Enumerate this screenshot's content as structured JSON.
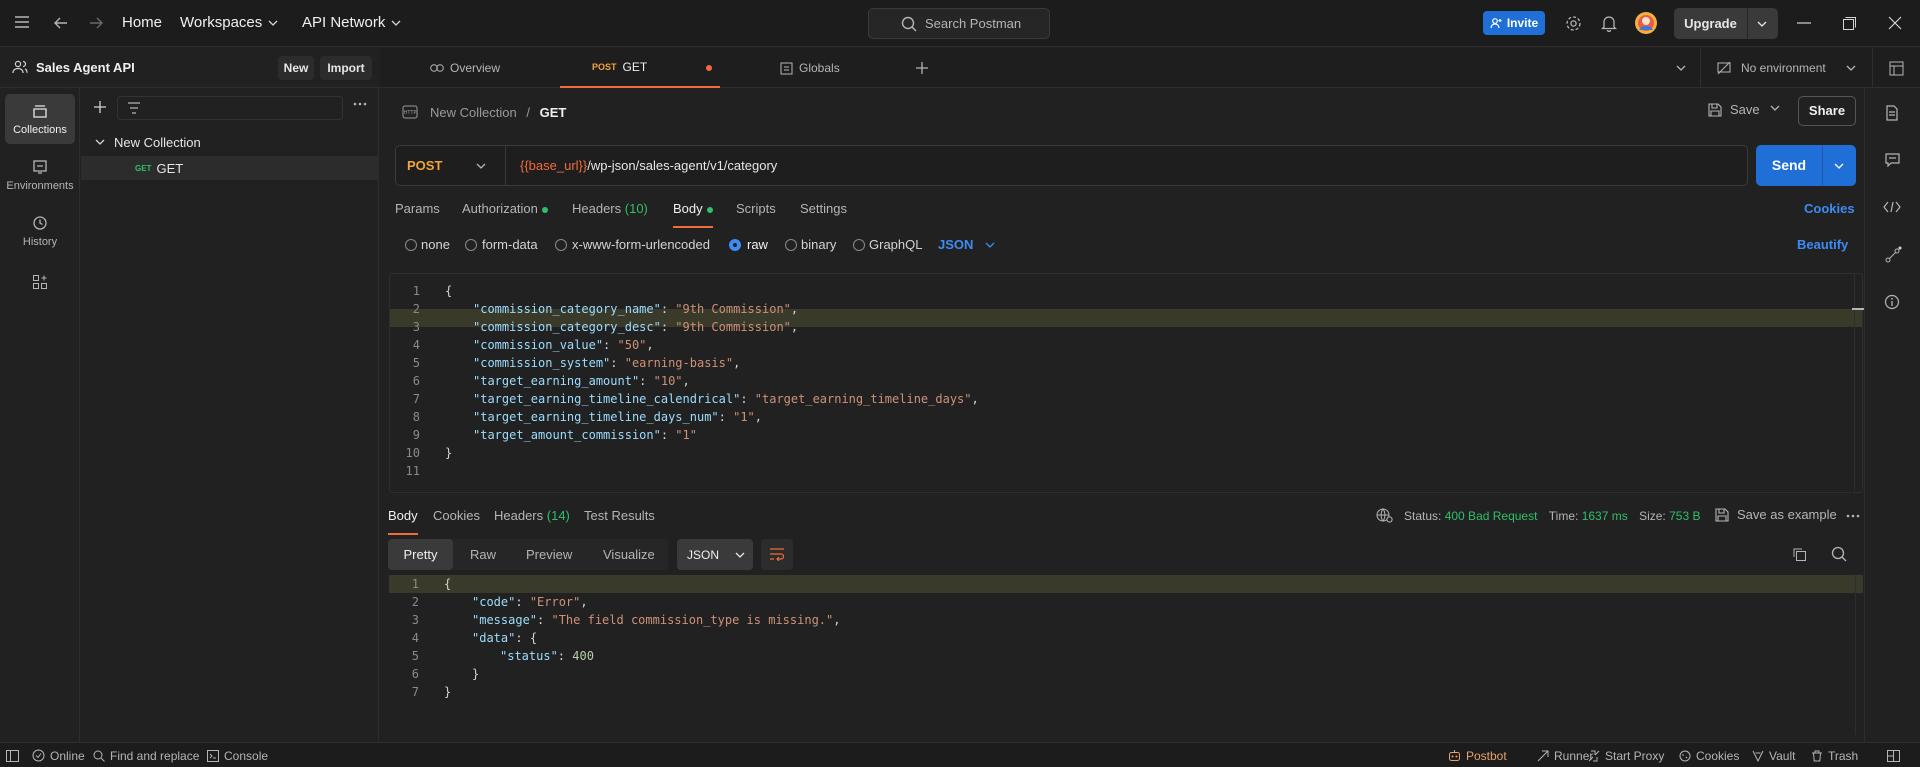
{
  "topbar": {
    "home": "Home",
    "workspaces": "Workspaces",
    "api_network": "API Network",
    "search_placeholder": "Search Postman",
    "invite": "Invite",
    "upgrade": "Upgrade"
  },
  "workspace": {
    "name": "Sales Agent API",
    "new_label": "New",
    "import_label": "Import"
  },
  "rail": {
    "collections": "Collections",
    "environments": "Environments",
    "history": "History"
  },
  "tree": {
    "collection_name": "New Collection",
    "request_method": "GET",
    "request_name": "GET"
  },
  "tabs": {
    "overview": "Overview",
    "active_method": "POST",
    "active_name": "GET",
    "globals": "Globals",
    "environment": "No environment"
  },
  "breadcrumb": {
    "collection": "New Collection",
    "separator": "/",
    "request": "GET"
  },
  "actions": {
    "save": "Save",
    "share": "Share",
    "send": "Send"
  },
  "request": {
    "method": "POST",
    "url_var": "{{base_url}}",
    "url_path": "/wp-json/sales-agent/v1/category"
  },
  "req_tabs": {
    "params": "Params",
    "authorization": "Authorization",
    "headers": "Headers",
    "headers_count": "(10)",
    "body": "Body",
    "scripts": "Scripts",
    "settings": "Settings",
    "cookies": "Cookies"
  },
  "body_types": {
    "none": "none",
    "form_data": "form-data",
    "urlencoded": "x-www-form-urlencoded",
    "raw": "raw",
    "binary": "binary",
    "graphql": "GraphQL",
    "format": "JSON",
    "beautify": "Beautify"
  },
  "request_body": [
    {
      "n": "1",
      "key": "",
      "val": "",
      "open": "{"
    },
    {
      "n": "2",
      "key": "\"commission_category_name\"",
      "val": "\"9th Commission\"",
      "comma": ","
    },
    {
      "n": "3",
      "key": "\"commission_category_desc\"",
      "val": "\"9th Commission\"",
      "comma": ","
    },
    {
      "n": "4",
      "key": "\"commission_value\"",
      "val": "\"50\"",
      "comma": ","
    },
    {
      "n": "5",
      "key": "\"commission_system\"",
      "val": "\"earning-basis\"",
      "comma": ","
    },
    {
      "n": "6",
      "key": "\"target_earning_amount\"",
      "val": "\"10\"",
      "comma": ","
    },
    {
      "n": "7",
      "key": "\"target_earning_timeline_calendrical\"",
      "val": "\"target_earning_timeline_days\"",
      "comma": ","
    },
    {
      "n": "8",
      "key": "\"target_earning_timeline_days_num\"",
      "val": "\"1\"",
      "comma": ","
    },
    {
      "n": "9",
      "key": "\"target_amount_commission\"",
      "val": "\"1\"",
      "comma": ""
    },
    {
      "n": "10",
      "key": "",
      "val": "",
      "open": "}"
    },
    {
      "n": "11",
      "key": "",
      "val": "",
      "open": ""
    }
  ],
  "response": {
    "tabs": {
      "body": "Body",
      "cookies": "Cookies",
      "headers": "Headers",
      "headers_count": "(14)",
      "test_results": "Test Results"
    },
    "status_label": "Status:",
    "status_value": "400 Bad Request",
    "time_label": "Time:",
    "time_value": "1637 ms",
    "size_label": "Size:",
    "size_value": "753 B",
    "save_example": "Save as example",
    "views": {
      "pretty": "Pretty",
      "raw": "Raw",
      "preview": "Preview",
      "visualize": "Visualize",
      "format": "JSON"
    },
    "lines": [
      {
        "n": "1",
        "text": "{"
      },
      {
        "n": "2",
        "key": "\"code\"",
        "val": "\"Error\"",
        "comma": ",",
        "indent": 1
      },
      {
        "n": "3",
        "key": "\"message\"",
        "val": "\"The field commission_type is missing.\"",
        "comma": ",",
        "indent": 1
      },
      {
        "n": "4",
        "key": "\"data\"",
        "open": "{",
        "indent": 1
      },
      {
        "n": "5",
        "key": "\"status\"",
        "num": "400",
        "indent": 2
      },
      {
        "n": "6",
        "text": "}",
        "indent": 1
      },
      {
        "n": "7",
        "text": "}"
      }
    ]
  },
  "statusbar": {
    "online": "Online",
    "find_replace": "Find and replace",
    "console": "Console",
    "postbot": "Postbot",
    "runner": "Runner",
    "start_proxy": "Start Proxy",
    "cookies": "Cookies",
    "vault": "Vault",
    "trash": "Trash"
  },
  "colors": {
    "accent_blue": "#1f6fd6",
    "post_orange": "#f0a63a",
    "status_green": "#2fbf6a",
    "url_var": "#f26b3a"
  }
}
